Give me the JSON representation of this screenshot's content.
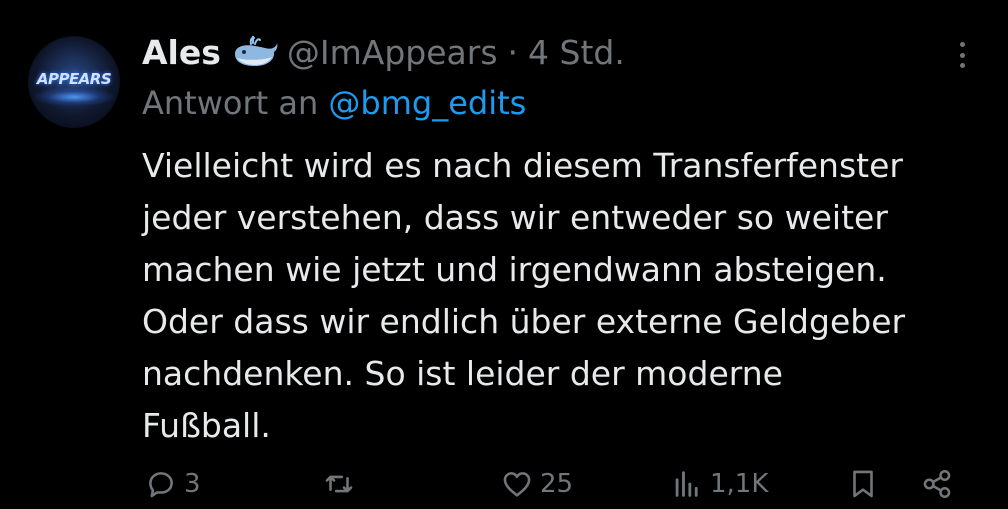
{
  "author": {
    "name": "Ales",
    "handle": "@ImAppears",
    "time": "4 Std.",
    "avatar_text": "APPEARS"
  },
  "separator": "·",
  "reply": {
    "prefix": "Antwort an",
    "mention": "@bmg_edits"
  },
  "body_lines": [
    "Vielleicht wird es nach diesem Transferfenster",
    "jeder verstehen, dass wir entweder so weiter",
    "machen wie jetzt und irgendwann absteigen.",
    "Oder dass wir endlich über externe Geldgeber",
    "nachdenken. So ist leider der moderne",
    "Fußball."
  ],
  "actions": {
    "replies": "3",
    "reposts": "",
    "likes": "25",
    "views": "1,1K"
  },
  "icons": {
    "name_badge": "whale-emoji",
    "reply": "speech-bubble-icon",
    "repost": "repost-icon",
    "like": "heart-icon",
    "views": "bar-chart-icon",
    "bookmark": "bookmark-icon",
    "share": "share-icon",
    "more": "more-dots-icon"
  },
  "colors": {
    "background": "#000000",
    "text": "#e7e9ea",
    "muted": "#71767b",
    "link": "#1d9bf0"
  }
}
